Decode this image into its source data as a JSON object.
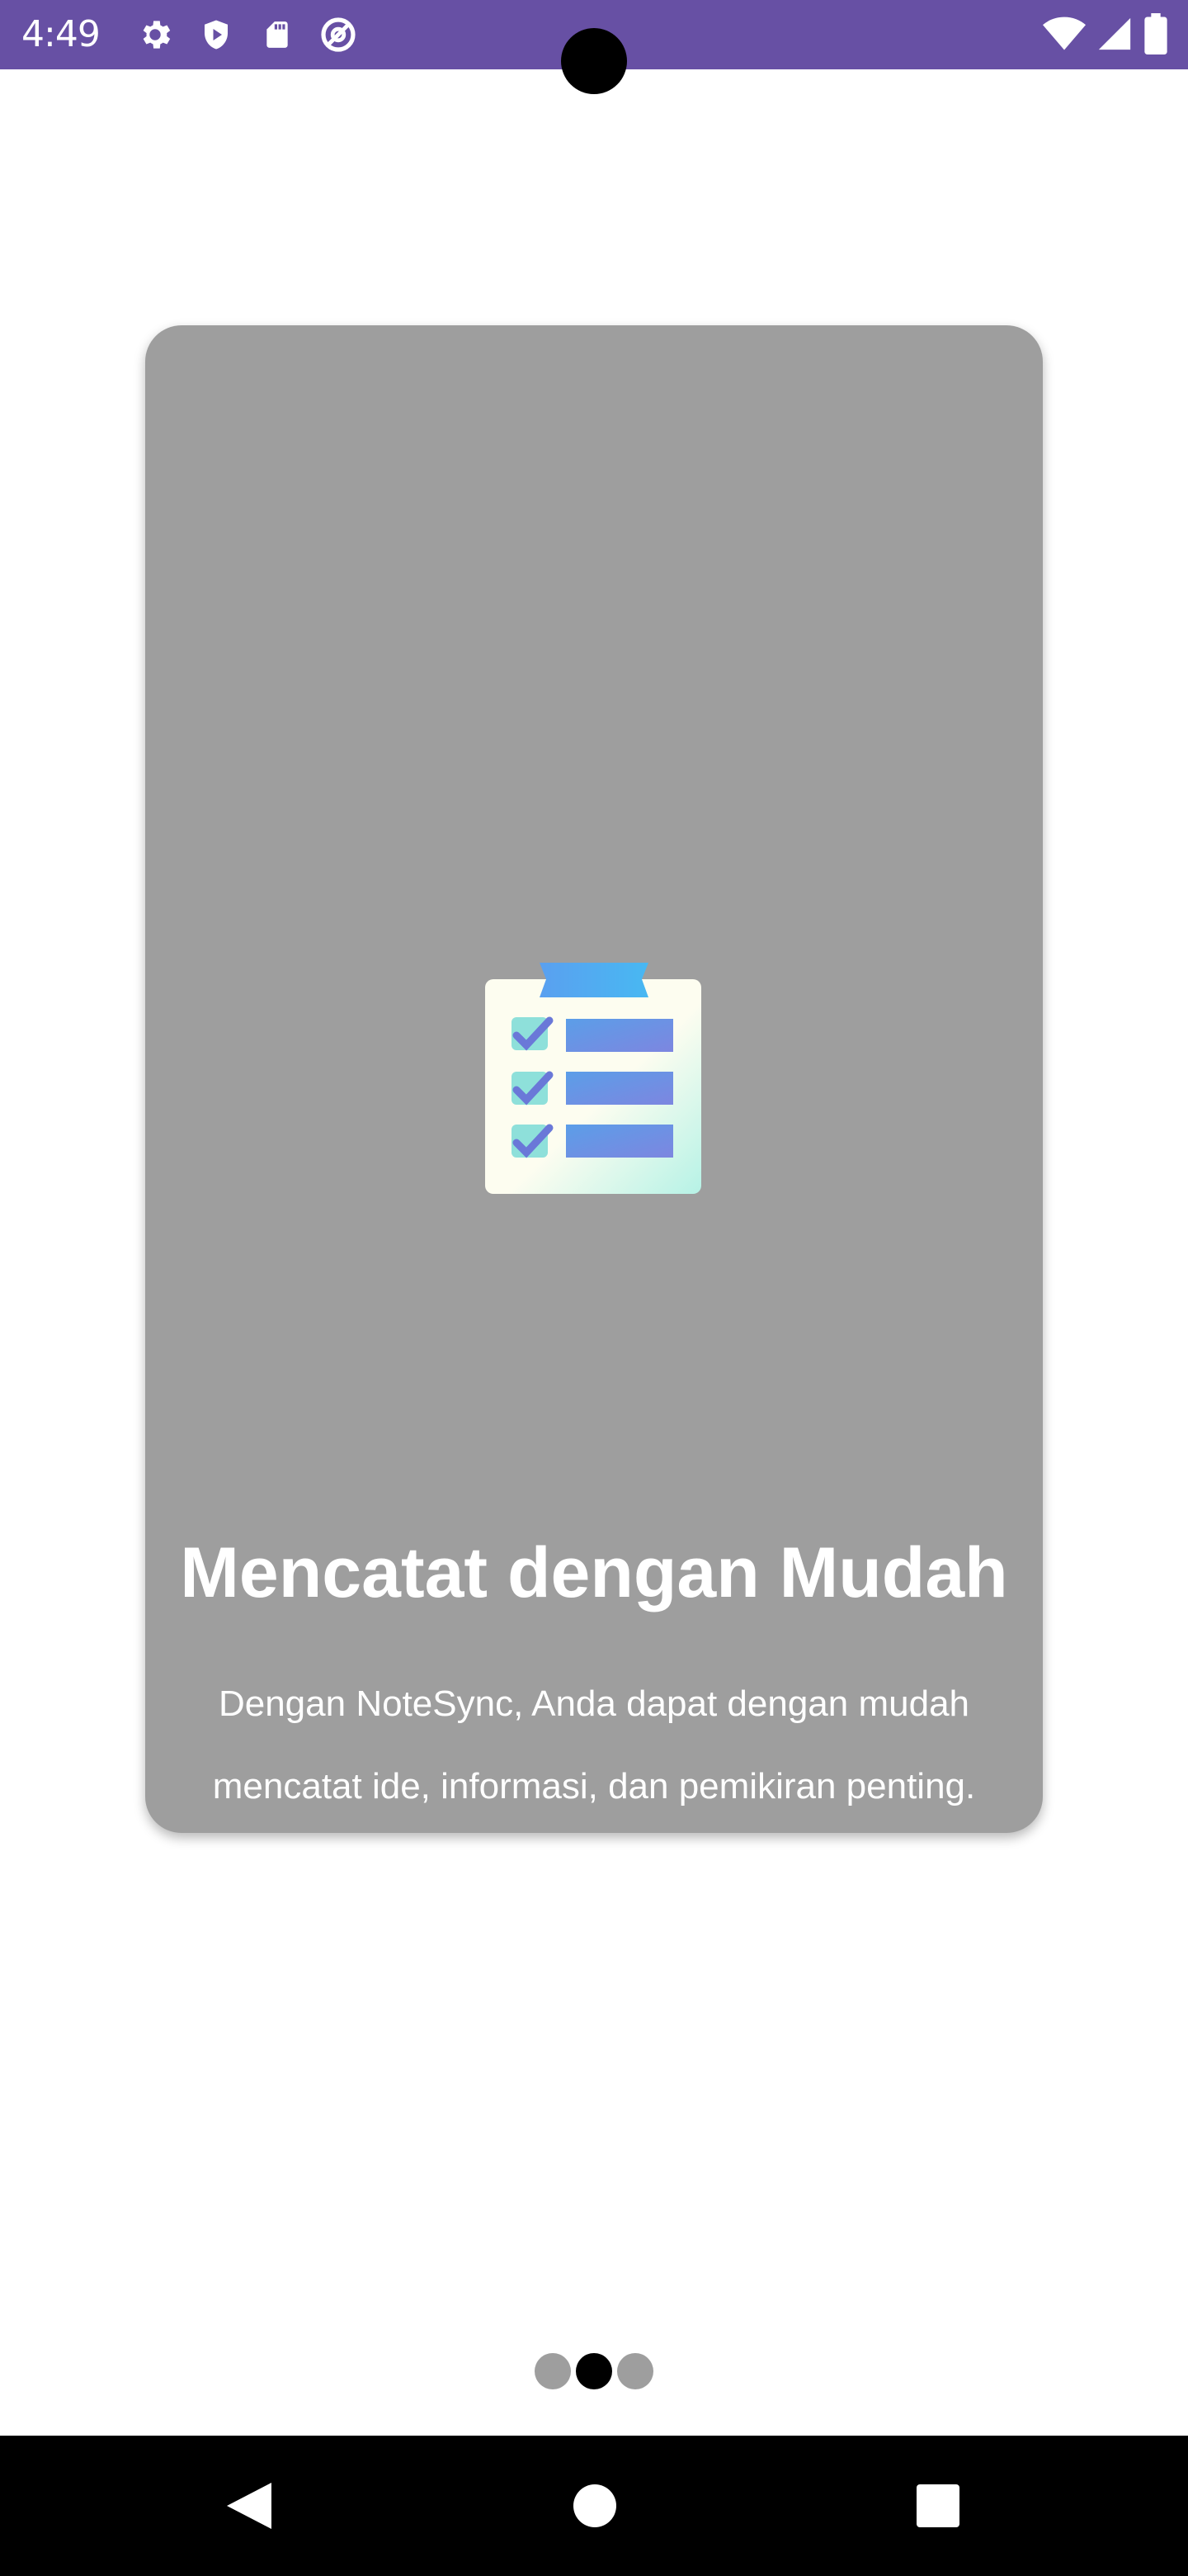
{
  "status_bar": {
    "time": "4:49",
    "background_color": "#6750a4",
    "left_icons": [
      "settings-icon",
      "shield-icon",
      "sd-card-icon",
      "at-sign-icon"
    ],
    "right_icons": [
      "wifi-icon",
      "signal-icon",
      "battery-icon"
    ]
  },
  "onboarding_card": {
    "title": "Mencatat dengan Mudah",
    "description_line_1": "Dengan NoteSync, Anda dapat dengan mudah",
    "description_line_2": "mencatat ide, informasi, dan pemikiran penting.",
    "background_color": "#9e9e9e",
    "illustration": "clipboard-checklist-icon"
  },
  "pager": {
    "total_pages": 3,
    "current_page": 2
  },
  "nav_bar": {
    "buttons": [
      "back-icon",
      "home-icon",
      "recents-icon"
    ]
  }
}
